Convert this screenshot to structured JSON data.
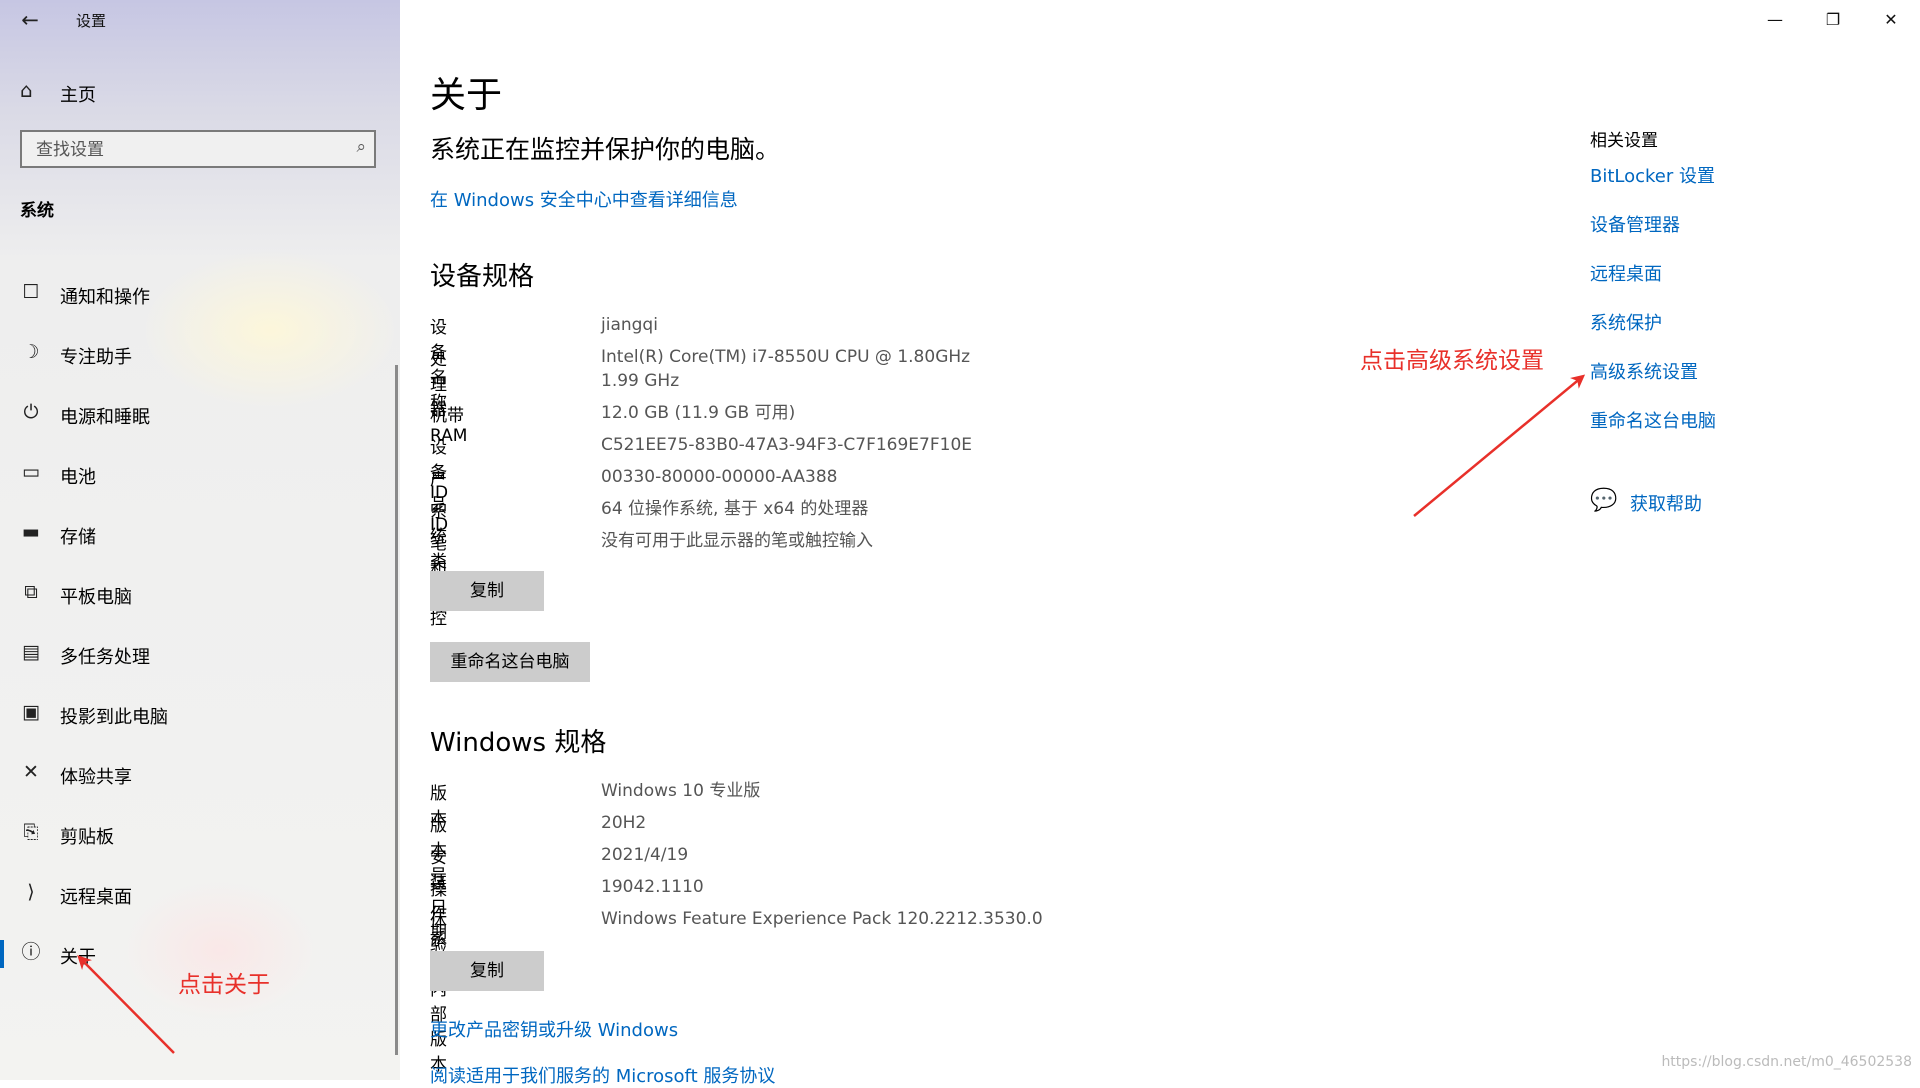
{
  "window": {
    "title": "设置",
    "min_icon": "minimize-icon",
    "max_icon": "restore-icon",
    "close_icon": "close-icon"
  },
  "sidebar": {
    "back_icon": "back-arrow-icon",
    "home_label": "主页",
    "search_placeholder": "查找设置",
    "section_label": "系统",
    "items": [
      {
        "label": "通知和操作",
        "icon": "notification-icon"
      },
      {
        "label": "专注助手",
        "icon": "moon-icon"
      },
      {
        "label": "电源和睡眠",
        "icon": "power-icon"
      },
      {
        "label": "电池",
        "icon": "battery-icon"
      },
      {
        "label": "存储",
        "icon": "storage-icon"
      },
      {
        "label": "平板电脑",
        "icon": "tablet-icon"
      },
      {
        "label": "多任务处理",
        "icon": "multitask-icon"
      },
      {
        "label": "投影到此电脑",
        "icon": "project-icon"
      },
      {
        "label": "体验共享",
        "icon": "share-icon"
      },
      {
        "label": "剪贴板",
        "icon": "clipboard-icon"
      },
      {
        "label": "远程桌面",
        "icon": "remote-desktop-icon"
      },
      {
        "label": "关于",
        "icon": "info-icon",
        "active": true
      }
    ]
  },
  "main": {
    "title": "关于",
    "protect_text": "系统正在监控并保护你的电脑。",
    "security_link": "在 Windows 安全中心中查看详细信息",
    "device_specs": {
      "heading": "设备规格",
      "rows": [
        {
          "key": "设备名称",
          "value": "jiangqi"
        },
        {
          "key": "处理器",
          "value": "Intel(R) Core(TM) i7-8550U CPU @ 1.80GHz   1.99 GHz"
        },
        {
          "key": "机带 RAM",
          "value": "12.0 GB (11.9 GB 可用)"
        },
        {
          "key": "设备 ID",
          "value": "C521EE75-83B0-47A3-94F3-C7F169E7F10E"
        },
        {
          "key": "产品 ID",
          "value": "00330-80000-00000-AA388"
        },
        {
          "key": "系统类型",
          "value": "64 位操作系统, 基于 x64 的处理器"
        },
        {
          "key": "笔和触控",
          "value": "没有可用于此显示器的笔或触控输入"
        }
      ],
      "copy_button": "复制",
      "rename_button": "重命名这台电脑"
    },
    "windows_specs": {
      "heading": "Windows 规格",
      "rows": [
        {
          "key": "版本",
          "value": "Windows 10 专业版"
        },
        {
          "key": "版本号",
          "value": "20H2"
        },
        {
          "key": "安装日期",
          "value": "2021/4/19"
        },
        {
          "key": "操作系统内部版本",
          "value": "19042.1110"
        },
        {
          "key": "体验",
          "value": "Windows Feature Experience Pack 120.2212.3530.0"
        }
      ],
      "copy_button": "复制"
    },
    "bottom_links": [
      "更改产品密钥或升级 Windows",
      "阅读适用于我们服务的 Microsoft 服务协议"
    ]
  },
  "related": {
    "title": "相关设置",
    "links": [
      "BitLocker 设置",
      "设备管理器",
      "远程桌面",
      "系统保护",
      "高级系统设置",
      "重命名这台电脑"
    ],
    "help_label": "获取帮助",
    "help_icon": "help-chat-icon"
  },
  "annotations": {
    "click_about": "点击关于",
    "click_advanced": "点击高级系统设置",
    "color": "#e8302a"
  },
  "watermark": "https://blog.csdn.net/m0_46502538",
  "colors": {
    "accent": "#0067c0",
    "button_bg": "#cccccc"
  }
}
